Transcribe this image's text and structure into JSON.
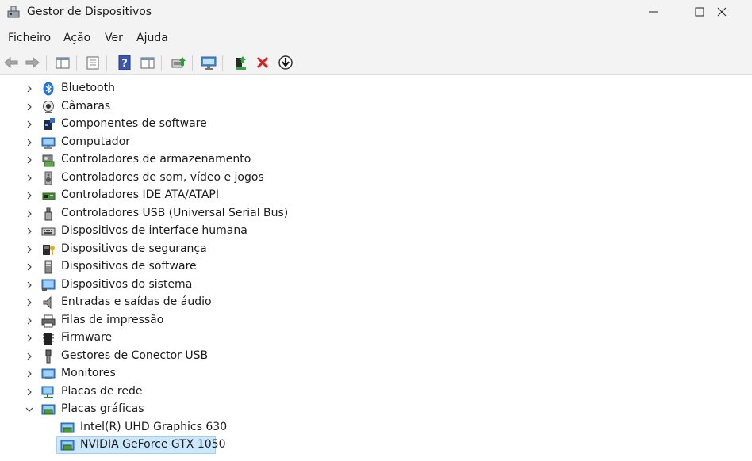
{
  "window": {
    "title": "Gestor de Dispositivos"
  },
  "menu": {
    "items": [
      "Ficheiro",
      "Ação",
      "Ver",
      "Ajuda"
    ]
  },
  "colors": {
    "selection": "#cce8ff",
    "selection_border": "#99d1ff",
    "chrome": "#f3f3f3"
  },
  "tree": {
    "categories": [
      {
        "label": "Bluetooth",
        "icon": "bluetooth-icon"
      },
      {
        "label": "Câmaras",
        "icon": "camera-icon"
      },
      {
        "label": "Componentes de software",
        "icon": "software-component-icon"
      },
      {
        "label": "Computador",
        "icon": "computer-icon"
      },
      {
        "label": "Controladores de armazenamento",
        "icon": "storage-controller-icon"
      },
      {
        "label": "Controladores de som, vídeo e jogos",
        "icon": "speaker-icon"
      },
      {
        "label": "Controladores IDE ATA/ATAPI",
        "icon": "ide-controller-icon"
      },
      {
        "label": "Controladores USB (Universal Serial Bus)",
        "icon": "usb-icon"
      },
      {
        "label": "Dispositivos de interface humana",
        "icon": "hid-keyboard-icon"
      },
      {
        "label": "Dispositivos de segurança",
        "icon": "security-device-icon"
      },
      {
        "label": "Dispositivos de software",
        "icon": "software-device-icon"
      },
      {
        "label": "Dispositivos do sistema",
        "icon": "system-device-icon"
      },
      {
        "label": "Entradas e saídas de áudio",
        "icon": "audio-io-icon"
      },
      {
        "label": "Filas de impressão",
        "icon": "printer-icon"
      },
      {
        "label": "Firmware",
        "icon": "firmware-chip-icon"
      },
      {
        "label": "Gestores de Conector USB",
        "icon": "usb-connector-icon"
      },
      {
        "label": "Monitores",
        "icon": "monitor-icon"
      },
      {
        "label": "Placas de rede",
        "icon": "network-adapter-icon"
      },
      {
        "label": "Placas gráficas",
        "icon": "display-adapter-icon",
        "expanded": true
      }
    ],
    "display_adapters": [
      {
        "label": "Intel(R) UHD Graphics 630",
        "icon": "display-adapter-icon",
        "selected": false
      },
      {
        "label": "NVIDIA GeForce GTX 1050",
        "icon": "display-adapter-icon",
        "selected": true
      }
    ]
  }
}
